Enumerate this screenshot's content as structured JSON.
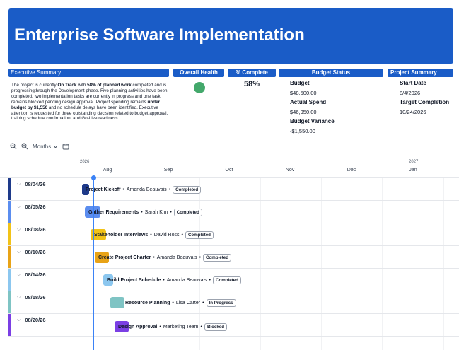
{
  "title": "Enterprise Software Implementation",
  "panels": {
    "executive_summary": "Executive Summary",
    "overall_health": "Overall Health",
    "percent_complete": "% Complete",
    "budget_status": "Budget Status",
    "project_summary": "Project Summary"
  },
  "summary": {
    "p1": "The project is currently ",
    "on_track": "On Track",
    "p2": " with ",
    "planned": "58% of planned work",
    "p3": " completed and is progressingthrough the Development phase. Five planning activities have been completed, two implementation tasks are currently in progress and one task remains blocked pending design approval. Project spending remains ",
    "under_budget": "under budget by $1,550",
    "p4": " and no schedule delays have been identified. Executive attention is requested for three outstanding decision related to budget approval, training schedule confirmation, and Go-Live readiness"
  },
  "health": {
    "color": "#43a86b"
  },
  "percent_complete": "58%",
  "budget": {
    "budget_label": "Budget",
    "budget_value": "$48,500.00",
    "actual_label": "Actual Spend",
    "actual_value": "$46,950.00",
    "variance_label": "Budget Variance",
    "variance_value": "-$1,550.00"
  },
  "project_summary": {
    "start_label": "Start Date",
    "start_value": "8/4/2026",
    "target_label": "Target Completion",
    "target_value": "10/24/2026"
  },
  "toolbar": {
    "months_label": "Months"
  },
  "timeline": {
    "year_2026": "2026",
    "year_2027": "2027",
    "months": [
      "Aug",
      "Sep",
      "Oct",
      "Nov",
      "Dec",
      "Jan"
    ]
  },
  "rows": [
    {
      "date": "08/04/26",
      "color": "#1e3a8a",
      "task": "Project Kickoff",
      "owner": "Amanda Beauvais",
      "status": "Completed"
    },
    {
      "date": "08/05/26",
      "color": "#5b8def",
      "task": "Gather Requirements",
      "owner": "Sarah Kim",
      "status": "Completed"
    },
    {
      "date": "08/08/26",
      "color": "#f2c318",
      "task": "Stakeholder Interviews",
      "owner": "David Ross",
      "status": "Completed"
    },
    {
      "date": "08/10/26",
      "color": "#e8a317",
      "task": "Create Project Charter",
      "owner": "Amanda Beauvais",
      "status": "Completed"
    },
    {
      "date": "08/14/26",
      "color": "#8cc7ef",
      "task": "Build Project Schedule",
      "owner": "Amanda Beauvais",
      "status": "Completed"
    },
    {
      "date": "08/18/26",
      "color": "#7fc4c4",
      "task": "Resource Planning",
      "owner": "Lisa Carter",
      "status": "In Progress"
    },
    {
      "date": "08/20/26",
      "color": "#7b3fe4",
      "task": "Design Approval",
      "owner": "Marketing Team",
      "status": "Blocked"
    }
  ],
  "separator": "•"
}
